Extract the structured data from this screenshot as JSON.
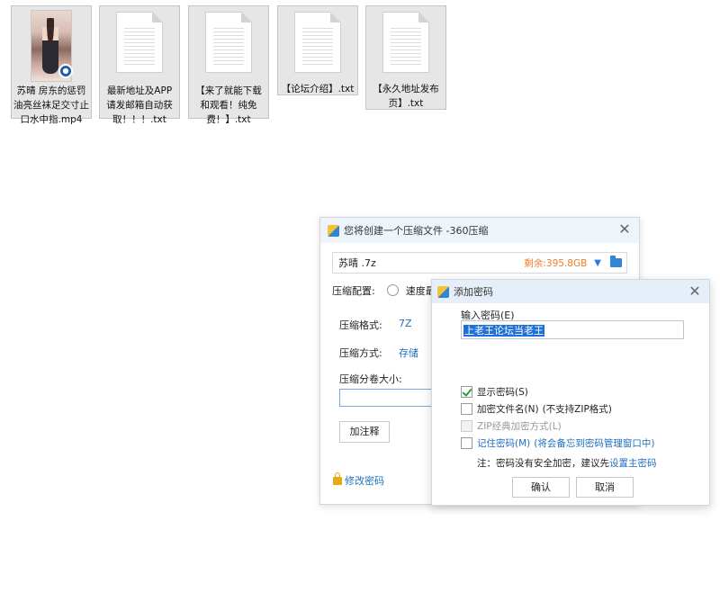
{
  "desktop_files": [
    {
      "name": "苏晴 房东的惩罚 油亮丝袜足交寸止口水中指.mp4",
      "type": "video"
    },
    {
      "name": "最新地址及APP 请发邮箱自动获 取！！！.txt",
      "type": "text"
    },
    {
      "name": "【来了就能下载 和观看！纯免 费！】.txt",
      "type": "text"
    },
    {
      "name": "【论坛介绍】.txt",
      "type": "text"
    },
    {
      "name": "【永久地址发布 页】.txt",
      "type": "text"
    }
  ],
  "main_window": {
    "title": "您将创建一个压缩文件 -360压缩",
    "filename": "苏晴 .7z",
    "remaining": "剩余:395.8GB",
    "config_label": "压缩配置:",
    "config_option": "速度最",
    "format_label": "压缩格式:",
    "format_value": "7Z",
    "method_label": "压缩方式:",
    "method_value": "存储",
    "volume_label": "压缩分卷大小:",
    "comment_button": "加注释",
    "change_password": "修改密码"
  },
  "password_dialog": {
    "title": "添加密码",
    "input_label": "输入密码(E)",
    "password_value": "上老王论坛当老王",
    "show_password": "显示密码(S)",
    "encrypt_filenames": "加密文件名(N)",
    "encrypt_filenames_note": "(不支持ZIP格式)",
    "zip_classic": "ZIP经典加密方式(L)",
    "remember_password": "记住密码(M)",
    "remember_note": "(将会备忘到密码管理窗口中)",
    "note_prefix": "注：密码没有安全加密，建议先",
    "note_link": "设置主密码",
    "ok_button": "确认",
    "cancel_button": "取消"
  },
  "colors": {
    "accent": "#1f6fc0",
    "remaining": "#ec7d2a",
    "selection": "#1d6ed6",
    "check": "#2c9a3a"
  }
}
